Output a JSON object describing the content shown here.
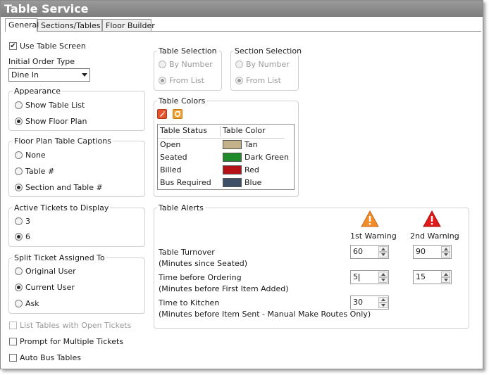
{
  "window": {
    "title": "Table Service"
  },
  "tabs": [
    {
      "label": "General",
      "active": true
    },
    {
      "label": "Sections/Tables",
      "active": false
    },
    {
      "label": "Floor Builder",
      "active": false
    }
  ],
  "use_table_screen": {
    "label": "Use Table Screen",
    "checked": true
  },
  "initial_order_type": {
    "label": "Initial Order Type",
    "value": "Dine In"
  },
  "appearance": {
    "label": "Appearance",
    "options": [
      {
        "label": "Show Table List",
        "selected": false
      },
      {
        "label": "Show Floor Plan",
        "selected": true
      }
    ]
  },
  "floor_plan_captions": {
    "label": "Floor Plan Table Captions",
    "options": [
      {
        "label": "None",
        "selected": false
      },
      {
        "label": "Table #",
        "selected": false
      },
      {
        "label": "Section and Table #",
        "selected": true
      }
    ]
  },
  "active_tickets": {
    "label": "Active Tickets to Display",
    "options": [
      {
        "label": "3",
        "selected": false
      },
      {
        "label": "6",
        "selected": true
      }
    ]
  },
  "split_ticket": {
    "label": "Split Ticket Assigned To",
    "options": [
      {
        "label": "Original User",
        "selected": false
      },
      {
        "label": "Current User",
        "selected": true
      },
      {
        "label": "Ask",
        "selected": false
      }
    ]
  },
  "checkboxes": [
    {
      "label": "List Tables with Open Tickets",
      "checked": false,
      "disabled": true
    },
    {
      "label": "Prompt for Multiple Tickets",
      "checked": false,
      "disabled": false
    },
    {
      "label": "Auto Bus Tables",
      "checked": false,
      "disabled": false
    }
  ],
  "table_selection": {
    "label": "Table Selection",
    "options": [
      {
        "label": "By Number",
        "selected": false
      },
      {
        "label": "From List",
        "selected": true
      }
    ]
  },
  "section_selection": {
    "label": "Section Selection",
    "options": [
      {
        "label": "By Number",
        "selected": false
      },
      {
        "label": "From List",
        "selected": true
      }
    ]
  },
  "table_colors": {
    "label": "Table Colors",
    "columns": [
      "Table Status",
      "Table Color"
    ],
    "rows": [
      {
        "status": "Open",
        "color_name": "Tan",
        "color": "#c3b18a"
      },
      {
        "status": "Seated",
        "color_name": "Dark Green",
        "color": "#1f8a2a"
      },
      {
        "status": "Billed",
        "color_name": "Red",
        "color": "#b51218"
      },
      {
        "status": "Bus Required",
        "color_name": "Blue",
        "color": "#3d5068"
      }
    ]
  },
  "table_alerts": {
    "label": "Table Alerts",
    "first_warning": "1st Warning",
    "second_warning": "2nd Warning",
    "first_icon_color": "#f08c2a",
    "second_icon_color": "#e01b1b",
    "rows": [
      {
        "title": "Table Turnover",
        "subtitle": "(Minutes since Seated)",
        "first": "60",
        "second": "90"
      },
      {
        "title": "Time before Ordering",
        "subtitle": "(Minutes before First Item Added)",
        "first": "5",
        "second": "15"
      },
      {
        "title": "Time to Kitchen",
        "subtitle": "(Minutes before Item Sent - Manual Make Routes Only)",
        "first": "30",
        "second": ""
      }
    ]
  }
}
